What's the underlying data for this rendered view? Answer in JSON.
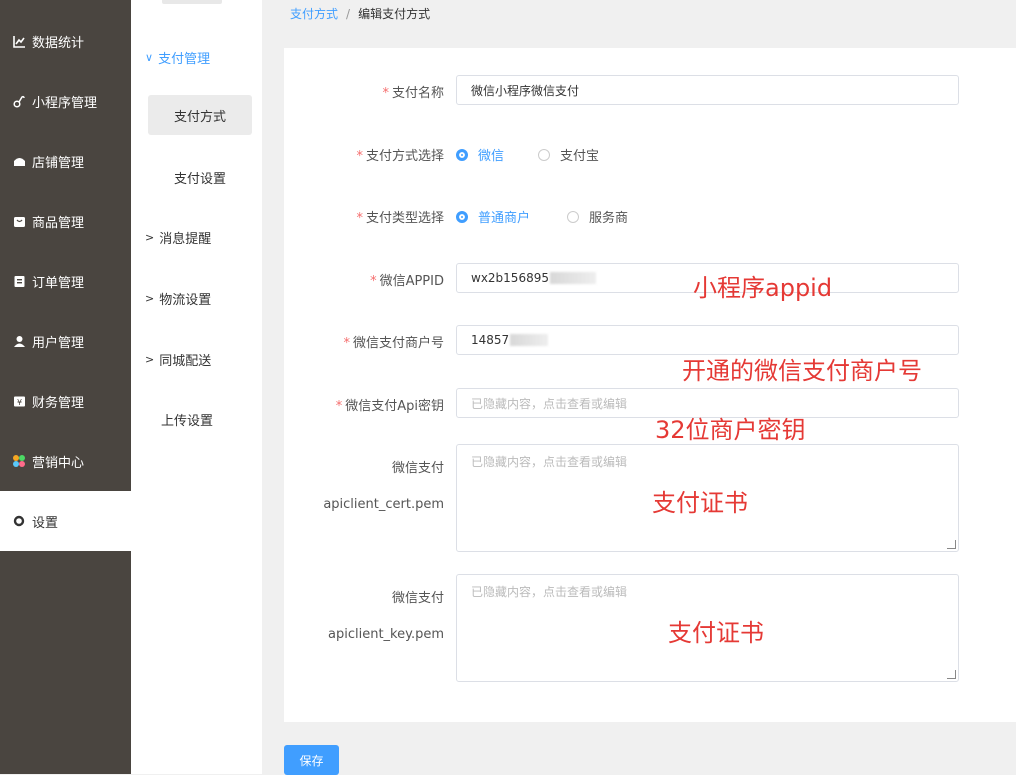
{
  "sidebar": {
    "items": [
      {
        "label": "数据统计",
        "icon": "line-chart-icon"
      },
      {
        "label": "小程序管理",
        "icon": "link-icon"
      },
      {
        "label": "店铺管理",
        "icon": "shop-icon"
      },
      {
        "label": "商品管理",
        "icon": "goods-icon"
      },
      {
        "label": "订单管理",
        "icon": "order-icon"
      },
      {
        "label": "用户管理",
        "icon": "user-icon"
      },
      {
        "label": "财务管理",
        "icon": "finance-icon"
      },
      {
        "label": "营销中心",
        "icon": "marketing-icon"
      },
      {
        "label": "设置",
        "icon": "settings-icon"
      }
    ]
  },
  "subnav": {
    "payment_group": "支付管理",
    "payment_method": "支付方式",
    "payment_settings": "支付设置",
    "message_group": "消息提醒",
    "logistics_group": "物流设置",
    "local_delivery_group": "同城配送",
    "upload_settings": "上传设置"
  },
  "breadcrumb": {
    "parent": "支付方式",
    "separator": "/",
    "current": "编辑支付方式"
  },
  "form": {
    "pay_name_label": "支付名称",
    "pay_name_value": "微信小程序微信支付",
    "pay_method_label": "支付方式选择",
    "pay_method_options": [
      "微信",
      "支付宝"
    ],
    "pay_method_selected": "微信",
    "pay_type_label": "支付类型选择",
    "pay_type_options": [
      "普通商户",
      "服务商"
    ],
    "pay_type_selected": "普通商户",
    "appid_label": "微信APPID",
    "appid_value": "wx2b156895",
    "mch_label": "微信支付商户号",
    "mch_value": "14857",
    "api_key_label": "微信支付Api密钥",
    "api_key_placeholder": "已隐藏内容，点击查看或编辑",
    "cert_label_line1": "微信支付",
    "cert_label_line2": "apiclient_cert.pem",
    "cert_placeholder": "已隐藏内容，点击查看或编辑",
    "key_label_line1": "微信支付",
    "key_label_line2": "apiclient_key.pem",
    "key_placeholder": "已隐藏内容，点击查看或编辑",
    "save_label": "保存"
  },
  "annotations": {
    "appid": "小程序appid",
    "mch": "开通的微信支付商户号",
    "api_key": "32位商户密钥",
    "cert": "支付证书",
    "key": "支付证书",
    "color": "#e53935"
  },
  "colors": {
    "accent": "#409eff",
    "sidebar_bg": "#4a4540",
    "required": "#f56c6c"
  }
}
